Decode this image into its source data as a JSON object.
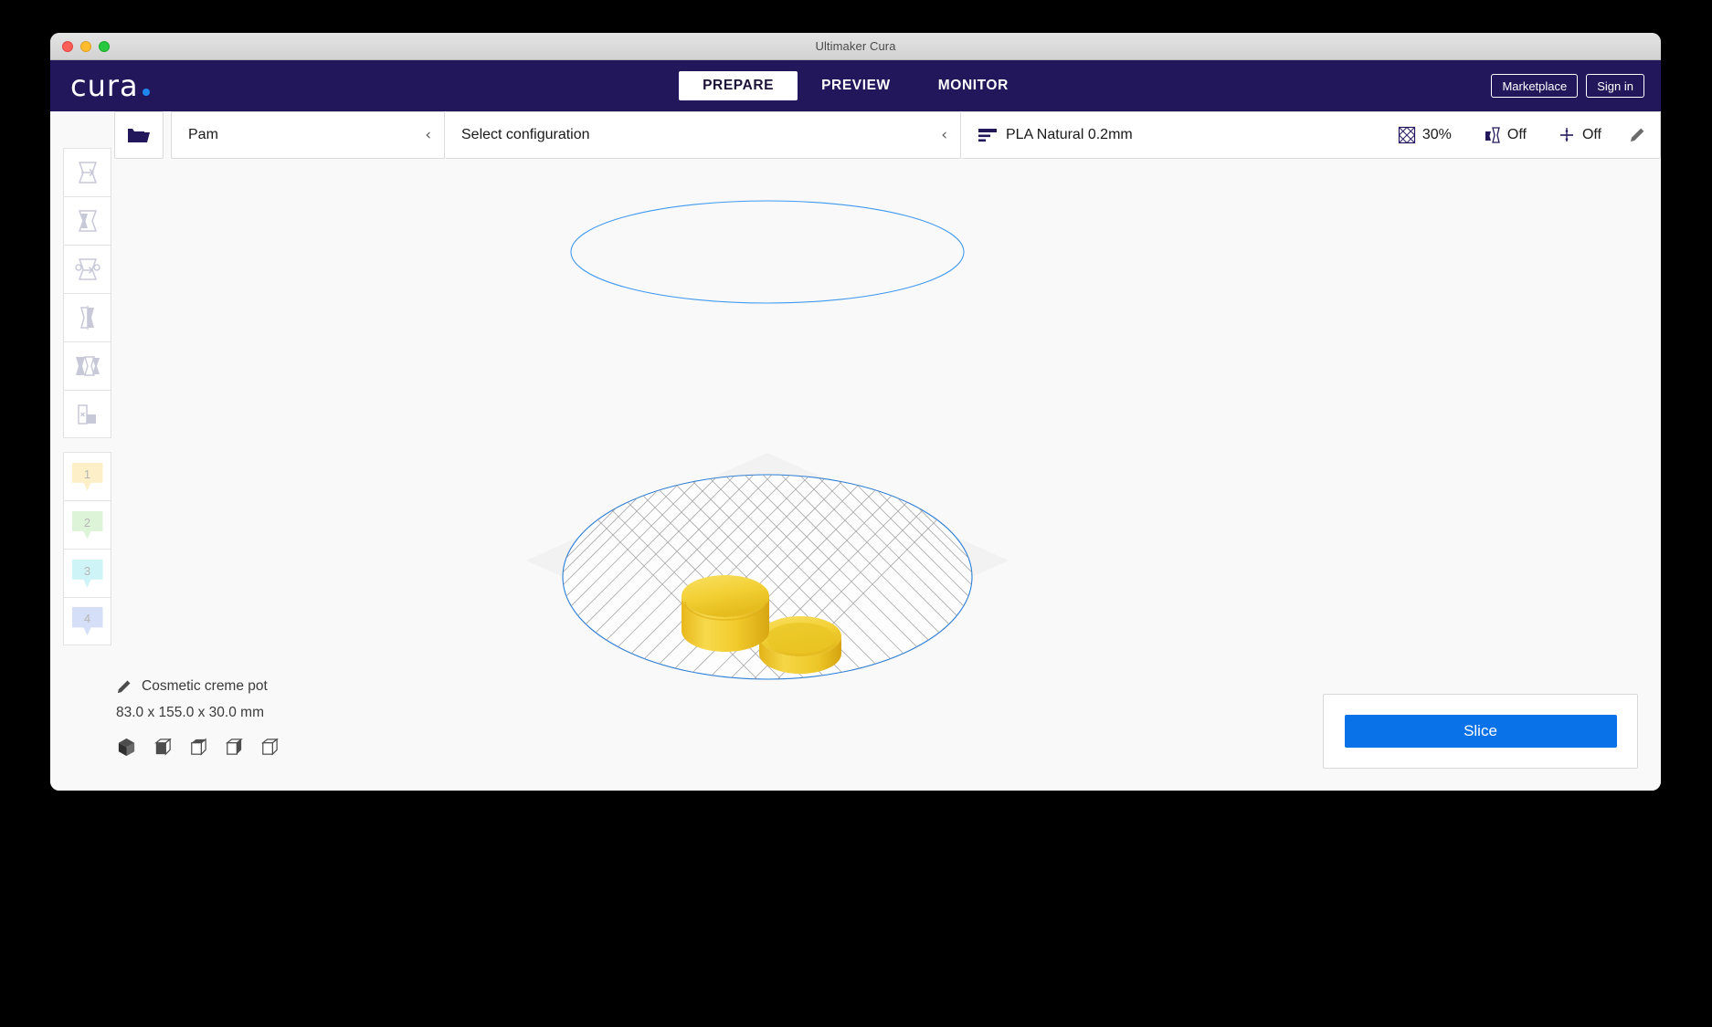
{
  "window": {
    "title": "Ultimaker Cura",
    "traffic_lights": [
      "close",
      "minimize",
      "maximize"
    ]
  },
  "header": {
    "logo_text": "cura",
    "logo_accent_color": "#1e88f0",
    "background_color": "#23175c",
    "tabs": [
      {
        "label": "PREPARE",
        "active": true
      },
      {
        "label": "PREVIEW",
        "active": false
      },
      {
        "label": "MONITOR",
        "active": false
      }
    ],
    "actions": [
      {
        "label": "Marketplace",
        "name": "marketplace-button"
      },
      {
        "label": "Sign in",
        "name": "sign-in-button"
      }
    ]
  },
  "config_bar": {
    "open_file_icon": "open-folder-icon",
    "printer": {
      "name": "Pam",
      "chevron": "‹"
    },
    "configuration": {
      "label": "Select configuration",
      "chevron": "‹"
    },
    "profile": {
      "icon": "layer-height-icon",
      "name": "PLA Natural 0.2mm",
      "settings": [
        {
          "icon": "infill-icon",
          "label": "30%",
          "name": "infill-setting"
        },
        {
          "icon": "support-icon",
          "label": "Off",
          "name": "support-setting"
        },
        {
          "icon": "adhesion-icon",
          "label": "Off",
          "name": "adhesion-setting"
        }
      ],
      "edit_icon": "pencil-icon"
    }
  },
  "toolbar": {
    "tools": [
      {
        "name": "move-tool",
        "icon": "move-icon"
      },
      {
        "name": "scale-tool",
        "icon": "scale-icon"
      },
      {
        "name": "rotate-tool",
        "icon": "rotate-icon"
      },
      {
        "name": "mirror-tool",
        "icon": "mirror-icon"
      },
      {
        "name": "per-model-settings-tool",
        "icon": "per-model-settings-icon"
      },
      {
        "name": "support-blocker-tool",
        "icon": "support-blocker-icon"
      }
    ],
    "extruders": [
      {
        "number": "1",
        "color": "#fdf0c9",
        "name": "extruder-1"
      },
      {
        "number": "2",
        "color": "#ddf4d8",
        "name": "extruder-2"
      },
      {
        "number": "3",
        "color": "#cff4f7",
        "name": "extruder-3"
      },
      {
        "number": "4",
        "color": "#d5dff7",
        "name": "extruder-4"
      }
    ]
  },
  "model_info": {
    "edit_icon": "pencil-icon",
    "name": "Cosmetic creme pot",
    "dimensions": "83.0 x 155.0 x 30.0 mm",
    "views": [
      {
        "name": "view-3d",
        "icon": "cube-isometric-icon"
      },
      {
        "name": "view-front",
        "icon": "cube-front-icon"
      },
      {
        "name": "view-top",
        "icon": "cube-top-icon"
      },
      {
        "name": "view-left",
        "icon": "cube-left-icon"
      },
      {
        "name": "view-right",
        "icon": "cube-right-icon"
      }
    ]
  },
  "action_panel": {
    "slice_label": "Slice",
    "slice_color": "#0a72e8"
  },
  "viewport": {
    "background_color": "#f9f9f9",
    "build_plate_outline_color": "#1e88f0",
    "model_color": "#f5d33b",
    "objects": [
      {
        "name": "creme-pot-base",
        "shape": "cylinder"
      },
      {
        "name": "creme-pot-lid",
        "shape": "cylinder"
      }
    ]
  }
}
